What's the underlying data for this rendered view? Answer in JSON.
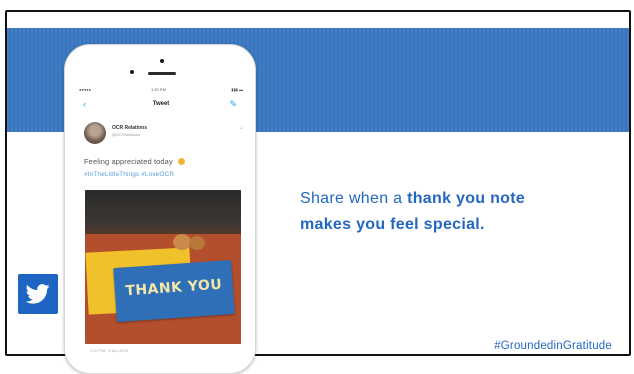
{
  "slide": {
    "message_prefix": "Share when a ",
    "message_bold_1": "thank you note",
    "message_bold_2": "makes you feel special.",
    "footer_hashtag": "#GroundedinGratitude",
    "colors": {
      "banner": "#3a79c2",
      "text_blue": "#2467c3",
      "twitter_badge": "#1e64c2"
    }
  },
  "phone": {
    "status": {
      "signal": "●●●●● ",
      "time": "1:20 PM",
      "battery": "▮▮▮ ▬"
    },
    "nav": {
      "back": "‹",
      "title": "Tweet",
      "compose": "✎"
    },
    "tweet": {
      "user_name": "OCR Relations",
      "user_handle": "@OCRrelations",
      "text": "Feeling appreciated today",
      "hashtags": "#InTheLittleThings #LoveOCR",
      "photo_card_text": "THANK YOU",
      "meta": "1:20 PM · 9 Apr 2018"
    }
  },
  "icons": {
    "twitter_logo": "twitter-bird-icon",
    "avatar": "avatar",
    "emoji": "smile-emoji-icon"
  }
}
